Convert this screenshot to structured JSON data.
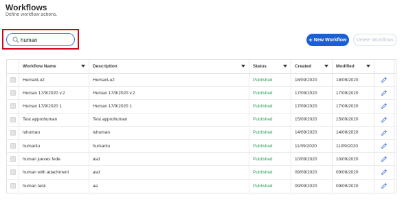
{
  "page": {
    "title": "Workflows",
    "subtitle": "Define workflow actions."
  },
  "search": {
    "value": "human",
    "placeholder": ""
  },
  "toolbar": {
    "new_label": "New Workflow",
    "new_icon": "plus-icon",
    "delete_label": "Delete Workflows"
  },
  "colors": {
    "accent": "#1a5fd6",
    "highlight": "#d0021b",
    "published": "#2e9e5b"
  },
  "table": {
    "columns": {
      "name": "Workflow Name",
      "description": "Description",
      "status": "Status",
      "created": "Created",
      "modified": "Modified"
    },
    "rows": [
      {
        "name": "HumanLu2",
        "description": "HumanLu2",
        "status": "Published",
        "created": "18/09/2020",
        "modified": "18/09/2020"
      },
      {
        "name": "Human 17/9/2020 v.2",
        "description": "Human 17/9/2020 v.2",
        "status": "Published",
        "created": "17/09/2020",
        "modified": "17/09/2020"
      },
      {
        "name": "Human 17/9/2020 1",
        "description": "Human 17/9/2020 1",
        "status": "Published",
        "created": "17/09/2020",
        "modified": "17/09/2020"
      },
      {
        "name": "Test approhuman",
        "description": "Test approhuman",
        "status": "Published",
        "created": "15/09/2020",
        "modified": "15/09/2020"
      },
      {
        "name": "luhuman",
        "description": "luhuman",
        "status": "Published",
        "created": "14/09/2020",
        "modified": "14/09/2020"
      },
      {
        "name": "humanlu",
        "description": "humanlu",
        "status": "Published",
        "created": "11/09/2020",
        "modified": "11/09/2020"
      },
      {
        "name": "human jueves fede",
        "description": "asd",
        "status": "Published",
        "created": "10/09/2020",
        "modified": "10/09/2020"
      },
      {
        "name": "human with attachment",
        "description": "asd",
        "status": "Published",
        "created": "09/09/2020",
        "modified": "09/09/2020"
      },
      {
        "name": "human task",
        "description": "aa",
        "status": "Published",
        "created": "09/09/2020",
        "modified": "09/09/2020"
      }
    ]
  }
}
